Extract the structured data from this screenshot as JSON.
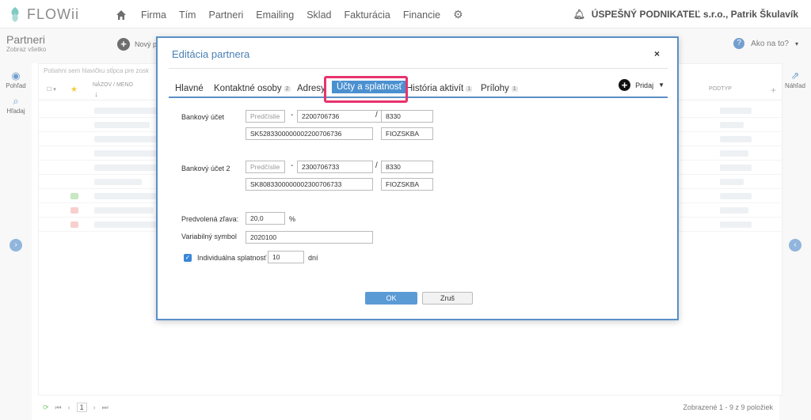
{
  "brand": {
    "name": "FLOWii",
    "accent": "#5b8fc6",
    "highlight": "#e8336d"
  },
  "nav": {
    "items": [
      "Firma",
      "Tím",
      "Partneri",
      "Emailing",
      "Sklad",
      "Fakturácia",
      "Financie"
    ]
  },
  "user": {
    "label": "ÚSPEŠNÝ PODNIKATEĽ s.r.o., Patrik Škulavík"
  },
  "page": {
    "title": "Partneri",
    "subtitle": "Zobraz všetko",
    "new_button": "Nový p",
    "help_label": "Ako na to?",
    "hint": "Potiahni sem hlavičku stĺpca pre zosk",
    "col_name": "NÁZOV / MENO",
    "col_type": "PODTYP",
    "pager_page": "1",
    "shown": "Zobrazené 1 - 9 z 9 položiek"
  },
  "left_rail": {
    "view": "Pohľad",
    "search": "Hľadaj"
  },
  "right_rail": {
    "preview": "Náhľad"
  },
  "modal": {
    "title": "Editácia partnera",
    "close": "×",
    "tabs": [
      {
        "label": "Hlavné",
        "count": ""
      },
      {
        "label": "Kontaktné osoby",
        "count": "2"
      },
      {
        "label": "Adresy",
        "count": ""
      },
      {
        "label": "Účty a splatnosť",
        "count": ""
      },
      {
        "label": "História aktivít",
        "count": "1"
      },
      {
        "label": "Prílohy",
        "count": "1"
      }
    ],
    "add_label": "Pridaj",
    "account1": {
      "label": "Bankový účet",
      "prefix_placeholder": "Predčíslie",
      "number": "2200706736",
      "bank_code": "8330",
      "iban": "SK5283300000002200706736",
      "swift": "FIOZSKBA"
    },
    "account2": {
      "label": "Bankový účet 2",
      "prefix_placeholder": "Predčíslie",
      "number": "2300706733",
      "bank_code": "8330",
      "iban": "SK8083300000002300706733",
      "swift": "FIOZSKBA"
    },
    "discount": {
      "label": "Predvolená zľava:",
      "value": "20,0",
      "unit": "%"
    },
    "variable_symbol": {
      "label": "Variabilný symbol",
      "value": "2020100"
    },
    "due": {
      "label": "Individuálna splatnosť",
      "value": "10",
      "unit": "dní",
      "checked": true
    },
    "ok": "OK",
    "cancel": "Zruš"
  }
}
